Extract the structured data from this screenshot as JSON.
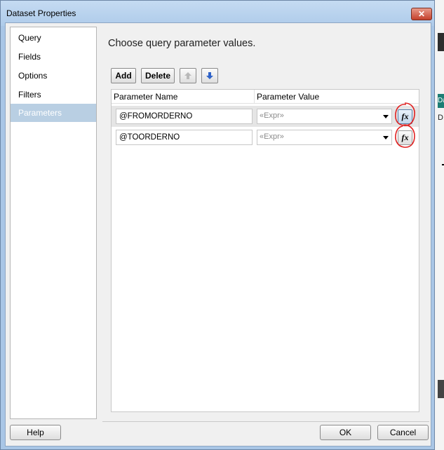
{
  "window": {
    "title": "Dataset Properties",
    "close_glyph": "✕"
  },
  "sidebar": {
    "items": [
      {
        "label": "Query"
      },
      {
        "label": "Fields"
      },
      {
        "label": "Options"
      },
      {
        "label": "Filters"
      },
      {
        "label": "Parameters",
        "selected": true
      }
    ]
  },
  "main": {
    "heading": "Choose query parameter values.",
    "toolbar": {
      "add_label": "Add",
      "delete_label": "Delete",
      "move_up_icon": "arrow-up-icon",
      "move_down_icon": "arrow-down-icon"
    },
    "grid": {
      "columns": [
        "Parameter Name",
        "Parameter Value"
      ],
      "rows": [
        {
          "name": "@FROMORDERNO",
          "value": "«Expr»",
          "fx": "fx"
        },
        {
          "name": "@TOORDERNO",
          "value": "«Expr»",
          "fx": "fx"
        }
      ]
    }
  },
  "footer": {
    "help_label": "Help",
    "ok_label": "OK",
    "cancel_label": "Cancel"
  },
  "colors": {
    "selection": "#b9cfe3",
    "annotation": "#e02020",
    "title_bar": "#b4cfea"
  },
  "background_app": {
    "tab_fragment": "Da",
    "row_fragment": "D"
  }
}
